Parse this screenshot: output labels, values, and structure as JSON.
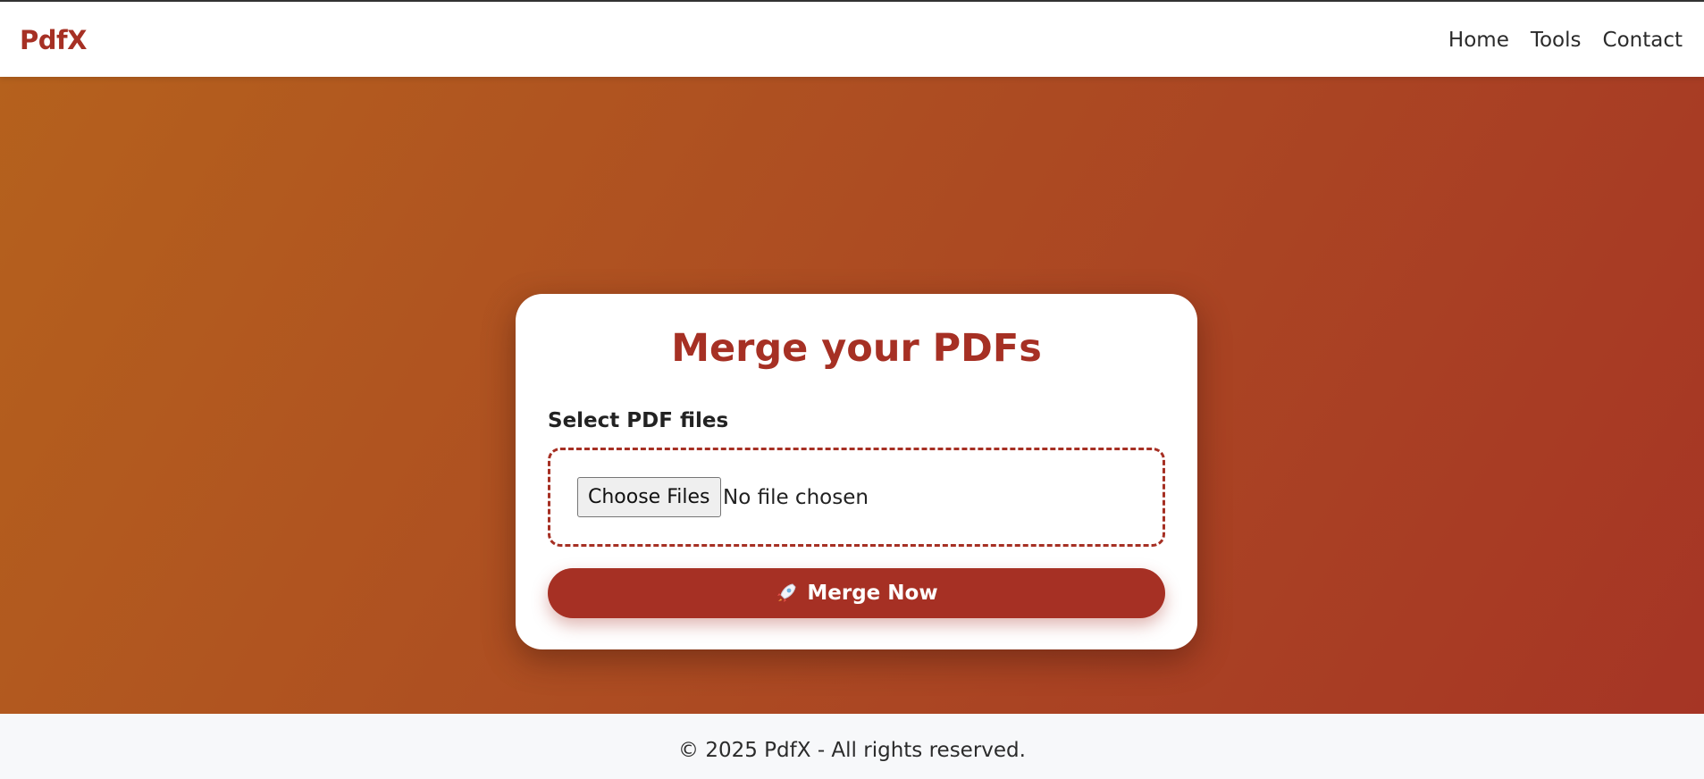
{
  "header": {
    "brand": "PdfX",
    "nav": [
      {
        "label": "Home"
      },
      {
        "label": "Tools"
      },
      {
        "label": "Contact"
      }
    ]
  },
  "card": {
    "title": "Merge your PDFs",
    "field_label": "Select PDF files",
    "file_button_label": "Choose Files",
    "file_status": "No file chosen",
    "merge_button_label": "Merge Now",
    "merge_button_icon": "rocket-icon"
  },
  "footer": {
    "text": "© 2025 PdfX - All rights reserved."
  },
  "colors": {
    "accent": "#a63024",
    "hero_gradient_start": "#b5611d",
    "hero_gradient_end": "#a63525",
    "footer_bg": "#f7f8fa"
  }
}
